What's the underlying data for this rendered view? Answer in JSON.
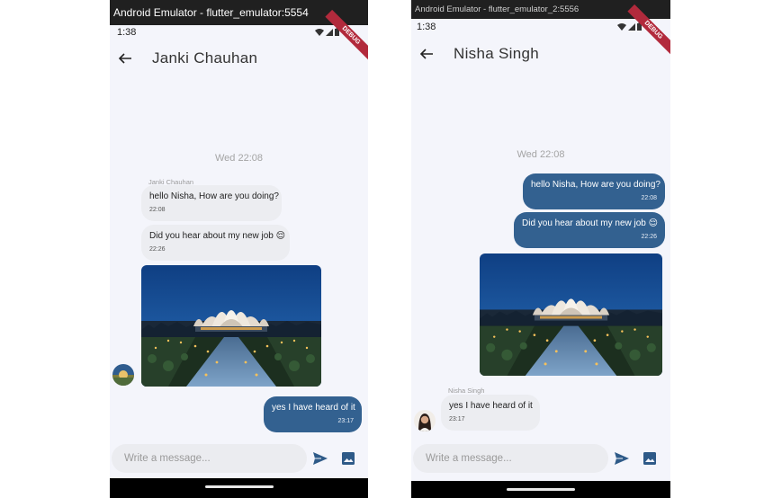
{
  "colors": {
    "outgoing_bubble": "#336190",
    "incoming_bubble": "#ecedf1",
    "screen_bg": "#f4f5fb",
    "accent_icon": "#2e5a88"
  },
  "left": {
    "window_title": "Android Emulator - flutter_emulator:5554",
    "time": "1:38",
    "debug": "DEBUG",
    "chat_title": "Janki Chauhan",
    "date": "Wed 22:08",
    "sender_name": "Janki Chauhan",
    "messages": [
      {
        "text": "hello Nisha, How are you doing?",
        "time": "22:08",
        "direction": "in"
      },
      {
        "text": "Did you hear about my new job 😌",
        "time": "22:26",
        "direction": "in"
      },
      {
        "image": "lotus-temple-photo",
        "direction": "in"
      },
      {
        "text": "yes I have heard of it",
        "time": "23:17",
        "direction": "out"
      }
    ],
    "composer_placeholder": "Write a message...",
    "icons": {
      "back": "arrow-back-icon",
      "send": "send-icon",
      "image": "image-icon"
    }
  },
  "right": {
    "window_title": "Android Emulator - flutter_emulator_2:5556",
    "time": "1:38",
    "debug": "DEBUG",
    "chat_title": "Nisha Singh",
    "date": "Wed 22:08",
    "sender_name": "Nisha Singh",
    "messages": [
      {
        "text": "hello Nisha, How are you doing?",
        "time": "22:08",
        "direction": "out"
      },
      {
        "text": "Did you hear about my new job 😌",
        "time": "22:26",
        "direction": "out"
      },
      {
        "image": "lotus-temple-photo",
        "direction": "out"
      },
      {
        "text": "yes I have heard of it",
        "time": "23:17",
        "direction": "in"
      }
    ],
    "composer_placeholder": "Write a message...",
    "icons": {
      "back": "arrow-back-icon",
      "send": "send-icon",
      "image": "image-icon"
    }
  }
}
